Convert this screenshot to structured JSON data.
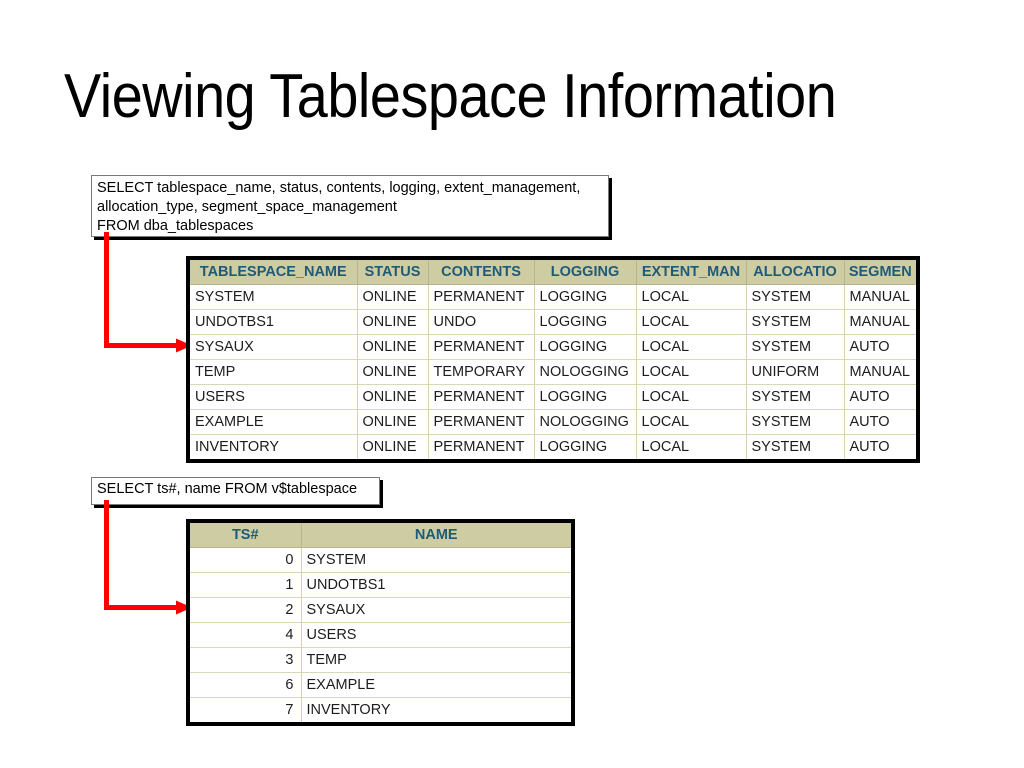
{
  "slide": {
    "title": "Viewing Tablespace Information",
    "background_color": "#ffffff",
    "title_color": "#000000"
  },
  "colors": {
    "header_background": "#cdcca2",
    "header_text": "#1f5b78",
    "grid_border": "#000000",
    "row_separator": "#d9d8b4",
    "connector_arrow": "#ff0000",
    "callout_shadow": "#000000"
  },
  "callouts": [
    {
      "id": "sql-dba-tablespaces",
      "text": "SELECT tablespace_name, status, contents, logging, extent_management,\nallocation_type, segment_space_management\nFROM dba_tablespaces"
    },
    {
      "id": "sql-v-tablespace",
      "text": "SELECT ts#, name FROM v$tablespace"
    }
  ],
  "grids": [
    {
      "id": "dba-tablespaces-result",
      "columns": [
        "TABLESPACE_NAME",
        "STATUS",
        "CONTENTS",
        "LOGGING",
        "EXTENT_MAN",
        "ALLOCATIO",
        "SEGMEN"
      ],
      "rows": [
        [
          "SYSTEM",
          "ONLINE",
          "PERMANENT",
          "LOGGING",
          "LOCAL",
          "SYSTEM",
          "MANUAL"
        ],
        [
          "UNDOTBS1",
          "ONLINE",
          "UNDO",
          "LOGGING",
          "LOCAL",
          "SYSTEM",
          "MANUAL"
        ],
        [
          "SYSAUX",
          "ONLINE",
          "PERMANENT",
          "LOGGING",
          "LOCAL",
          "SYSTEM",
          "AUTO"
        ],
        [
          "TEMP",
          "ONLINE",
          "TEMPORARY",
          "NOLOGGING",
          "LOCAL",
          "UNIFORM",
          "MANUAL"
        ],
        [
          "USERS",
          "ONLINE",
          "PERMANENT",
          "LOGGING",
          "LOCAL",
          "SYSTEM",
          "AUTO"
        ],
        [
          "EXAMPLE",
          "ONLINE",
          "PERMANENT",
          "NOLOGGING",
          "LOCAL",
          "SYSTEM",
          "AUTO"
        ],
        [
          "INVENTORY",
          "ONLINE",
          "PERMANENT",
          "LOGGING",
          "LOCAL",
          "SYSTEM",
          "AUTO"
        ]
      ]
    },
    {
      "id": "v-tablespace-result",
      "columns": [
        "TS#",
        "NAME"
      ],
      "rows": [
        [
          "0",
          "SYSTEM"
        ],
        [
          "1",
          "UNDOTBS1"
        ],
        [
          "2",
          "SYSAUX"
        ],
        [
          "4",
          "USERS"
        ],
        [
          "3",
          "TEMP"
        ],
        [
          "6",
          "EXAMPLE"
        ],
        [
          "7",
          "INVENTORY"
        ]
      ]
    }
  ]
}
